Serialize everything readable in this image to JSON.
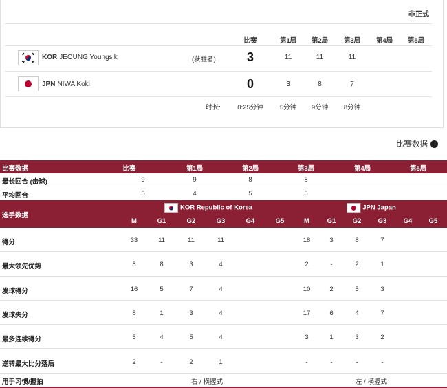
{
  "status": "非正式",
  "headers": {
    "match": "比赛",
    "g1": "第1局",
    "g2": "第2局",
    "g3": "第3局",
    "g4": "第4局",
    "g5": "第5局"
  },
  "players": [
    {
      "noc": "KOR",
      "name": "JEOUNG Youngsik",
      "winner_label": "(获胜者)",
      "match": "3",
      "games": [
        "11",
        "11",
        "11",
        "",
        ""
      ]
    },
    {
      "noc": "JPN",
      "name": "NIWA Koki",
      "winner_label": "",
      "match": "0",
      "games": [
        "3",
        "8",
        "7",
        "",
        ""
      ]
    }
  ],
  "duration": {
    "label": "时长:",
    "match": "0:25分钟",
    "g1": "5分钟",
    "g2": "9分钟",
    "g3": "8分钟"
  },
  "stats_toggle": "比赛数据",
  "match_stats": {
    "header": {
      "label": "比赛数据",
      "match": "比赛",
      "g1": "第1局",
      "g2": "第2局",
      "g3": "第3局",
      "g4": "第4局",
      "g5": "第5局"
    },
    "rows": [
      {
        "label": "最长回合 (击球)",
        "match": "9",
        "g1": "9",
        "g2": "8",
        "g3": "8",
        "g4": "",
        "g5": ""
      },
      {
        "label": "平均回合",
        "match": "5",
        "g1": "4",
        "g2": "5",
        "g3": "5",
        "g4": "",
        "g5": ""
      }
    ]
  },
  "player_stats": {
    "label": "选手数据",
    "team1": "KOR Republic of Korea",
    "team2": "JPN Japan",
    "cols": [
      "M",
      "G1",
      "G2",
      "G3",
      "G4",
      "G5"
    ],
    "rows": [
      {
        "label": "得分",
        "kor": [
          "33",
          "11",
          "11",
          "11",
          "",
          ""
        ],
        "jpn": [
          "18",
          "3",
          "8",
          "7",
          "",
          ""
        ]
      },
      {
        "label": "最大领先优势",
        "kor": [
          "8",
          "8",
          "3",
          "4",
          "",
          ""
        ],
        "jpn": [
          "2",
          "-",
          "2",
          "1",
          "",
          ""
        ]
      },
      {
        "label": "发球得分",
        "kor": [
          "16",
          "5",
          "7",
          "4",
          "",
          ""
        ],
        "jpn": [
          "10",
          "2",
          "5",
          "3",
          "",
          ""
        ]
      },
      {
        "label": "发球失分",
        "kor": [
          "8",
          "1",
          "3",
          "4",
          "",
          ""
        ],
        "jpn": [
          "17",
          "6",
          "4",
          "7",
          "",
          ""
        ]
      },
      {
        "label": "最多连续得分",
        "kor": [
          "5",
          "4",
          "5",
          "4",
          "",
          ""
        ],
        "jpn": [
          "3",
          "1",
          "3",
          "2",
          "",
          ""
        ]
      },
      {
        "label": "逆转最大比分落后",
        "kor": [
          "2",
          "-",
          "2",
          "1",
          "",
          ""
        ],
        "jpn": [
          "-",
          "-",
          "-",
          "-",
          "",
          ""
        ]
      }
    ],
    "hand": {
      "label": "用手习惯/握拍",
      "kor": "右 / 横握式",
      "jpn": "左 / 横握式"
    }
  }
}
